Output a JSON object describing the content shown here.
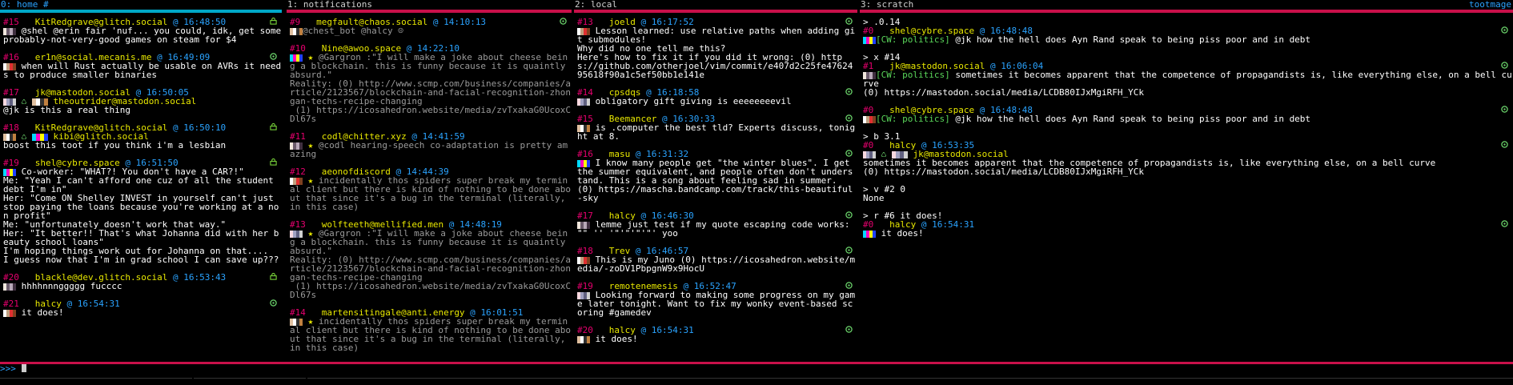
{
  "panes": [
    {
      "title": "0: home #",
      "bar_color": "#00a8c8",
      "posts": [
        {
          "num": "#15",
          "acct": "KitRedgrave@glitch.social",
          "ts": "16:48:50",
          "icon": "lock",
          "body": " @shel @erin fair 'nuf... you could, idk, get some probably-not-very-good games on steam for $4"
        },
        {
          "num": "#16",
          "acct": "er1n@social.mecanis.me",
          "ts": "16:49:09",
          "icon": "reply",
          "body": " when will Rust actually be usable on AVRs it needs to produce smaller binaries"
        },
        {
          "num": "#17",
          "acct": "jk@mastodon.social",
          "ts": "16:50:05",
          "icon": "",
          "boost": "theoutrider@mastodon.social",
          "body": "@jk is this a real thing"
        },
        {
          "num": "#18",
          "acct": "KitRedgrave@glitch.social",
          "ts": "16:50:10",
          "icon": "lock",
          "boost": "kibi@glitch.social",
          "body": "boost this toot if you think i'm a lesbian"
        },
        {
          "num": "#19",
          "acct": "shel@cybre.space",
          "ts": "16:51:50",
          "icon": "lock",
          "body": " Co-worker: \"WHAT?! You don't have a CAR?!\"\nMe: \"Yeah I can't afford one cuz of all the student debt I'm in\"\nHer: \"Come ON Shelley INVEST in yourself can't just stop paying the loans because you're working at a non profit\"\nMe: \"unfortunately doesn't work that way.\"\nHer: \"It better!! That's what Johanna did with her beauty school loans\"\nI'm hoping things work out for Johanna on that....\nI guess now that I'm in grad school I can save up???"
        },
        {
          "num": "#20",
          "acct": "blackle@dev.glitch.social",
          "ts": "16:53:43",
          "icon": "lock",
          "body": " hhhhnnnggggg fucccc"
        },
        {
          "num": "#21",
          "acct": "halcy",
          "ts": "16:54:31",
          "icon": "reply",
          "body": " it does!"
        }
      ]
    },
    {
      "title": "1: notifications",
      "bar_color": "#c8104a",
      "posts": [
        {
          "num": "#9",
          "acct": "megfault@chaos.social",
          "ts": "14:10:13",
          "icon": "reply",
          "body": "@chest_bot @halcy ☹"
        },
        {
          "num": "#10",
          "acct": "Nine@awoo.space",
          "ts": "14:22:10",
          "icon": "",
          "fav": true,
          "body": "@Gargron :\"I will make a joke about cheese being a blockchain. this is funny because it is quaintly absurd.\"\nReality: (0) http://www.scmp.com/business/companies/article/2123567/blockchain-and-facial-recognition-zhongan-techs-recipe-changing\n (1) https://icosahedron.website/media/zvTxakaG0UcoxCDl67s"
        },
        {
          "num": "#11",
          "acct": "codl@chitter.xyz",
          "ts": "14:41:59",
          "icon": "",
          "fav": true,
          "body": "@codl hearing-speech co-adaptation is pretty amazing"
        },
        {
          "num": "#12",
          "acct": "aeonofdiscord",
          "ts": "14:44:39",
          "icon": "",
          "fav": true,
          "body": "incidentally thos spiders super break my terminal client but there is kind of nothing to be done about that since it's a bug in the terminal (literally, in this case)"
        },
        {
          "num": "#13",
          "acct": "wolfteeth@mellified.men",
          "ts": "14:48:19",
          "icon": "",
          "fav": true,
          "body": "@Gargron :\"I will make a joke about cheese being a blockchain. this is funny because it is quaintly absurd.\"\nReality: (0) http://www.scmp.com/business/companies/article/2123567/blockchain-and-facial-recognition-zhongan-techs-recipe-changing\n (1) https://icosahedron.website/media/zvTxakaG0UcoxCDl67s"
        },
        {
          "num": "#14",
          "acct": "martensitingale@anti.energy",
          "ts": "16:01:51",
          "icon": "",
          "fav": true,
          "body": "incidentally thos spiders super break my terminal client but there is kind of nothing to be done about that since it's a bug in the terminal (literally, in this case)"
        }
      ]
    },
    {
      "title": "2: local",
      "bar_color": "#c8104a",
      "posts": [
        {
          "num": "#13",
          "acct": "joeld",
          "ts": "16:17:52",
          "icon": "reply",
          "body": " Lesson learned: use relative paths when adding git submodules!\nWhy did no one tell me this?\nHere's how to fix it if you did it wrong: (0) https://github.com/otherjoel/vim/commit/e407d2c25fe4762495618f90a1c5ef50bb1e141e"
        },
        {
          "num": "#14",
          "acct": "cpsdqs",
          "ts": "16:18:58",
          "icon": "reply",
          "body": " obligatory gift giving is eeeeeeeevil"
        },
        {
          "num": "#15",
          "acct": "Beemancer",
          "ts": "16:30:33",
          "icon": "reply",
          "body": " is .computer the best tld? Experts discuss, tonight at 8."
        },
        {
          "num": "#16",
          "acct": "masu",
          "ts": "16:31:32",
          "icon": "reply",
          "body": " I know many people get \"the winter blues\". I get the summer equivalent, and people often don't understand. This is a song about feeling sad in summer.\n(0) https://mascha.bandcamp.com/track/this-beautiful-sky"
        },
        {
          "num": "#17",
          "acct": "halcy",
          "ts": "16:46:30",
          "icon": "reply",
          "body": " lemme just test if my quote escaping code works: \"\" '' '\"'\"'\"'\"' yoo"
        },
        {
          "num": "#18",
          "acct": "Trev",
          "ts": "16:46:57",
          "icon": "reply",
          "body": " This is my Juno (0) https://icosahedron.website/media/-zoDV1PbpgnW9x9HocU"
        },
        {
          "num": "#19",
          "acct": "remotenemesis",
          "ts": "16:52:47",
          "icon": "reply",
          "body": " Looking forward to making some progress on my game later tonight. Want to fix my wonky event-based scoring #gamedev"
        },
        {
          "num": "#20",
          "acct": "halcy",
          "ts": "16:54:31",
          "icon": "reply",
          "body": " it does!"
        }
      ]
    },
    {
      "title": "3: scratch",
      "right_title": "tootmage",
      "bar_color": "#c8104a",
      "posts": [
        {
          "cmd": "> .0.14",
          "num": "#0",
          "acct": "shel@cybre.space",
          "ts": "16:48:48",
          "icon": "reply",
          "cw": "[CW: politics]",
          "body": " @jk how the hell does Ayn Rand speak to being piss poor and in debt"
        },
        {
          "cmd": "> x #14",
          "num": "#1",
          "acct": "jk@mastodon.social",
          "ts": "16:06:04",
          "icon": "reply",
          "cw": "[CW: politics]",
          "body": " sometimes it becomes apparent that the competence of propagandists is, like everything else, on a bell curve\n(0) https://mastodon.social/media/LCDB80IJxMgiRFH_YCk"
        },
        {
          "cmd": "",
          "num": "#0",
          "acct": "shel@cybre.space",
          "ts": "16:48:48",
          "icon": "reply",
          "cw": "[CW: politics]",
          "body": " @jk how the hell does Ayn Rand speak to being piss poor and in debt"
        },
        {
          "cmd": "> b 3.1",
          "num": "#0",
          "acct": "halcy",
          "ts": "16:53:35",
          "icon": "reply",
          "boost": "jk@mastodon.social",
          "body": "sometimes it becomes apparent that the competence of propagandists is, like everything else, on a bell curve\n(0) https://mastodon.social/media/LCDB80IJxMgiRFH_YCk"
        },
        {
          "cmd": "> v #2 0",
          "plain": "None"
        },
        {
          "cmd": "> r #6 it does!",
          "num": "#0",
          "acct": "halcy",
          "ts": "16:54:31",
          "icon": "reply",
          "body": " it does!"
        }
      ]
    }
  ],
  "prompt": ">>> "
}
